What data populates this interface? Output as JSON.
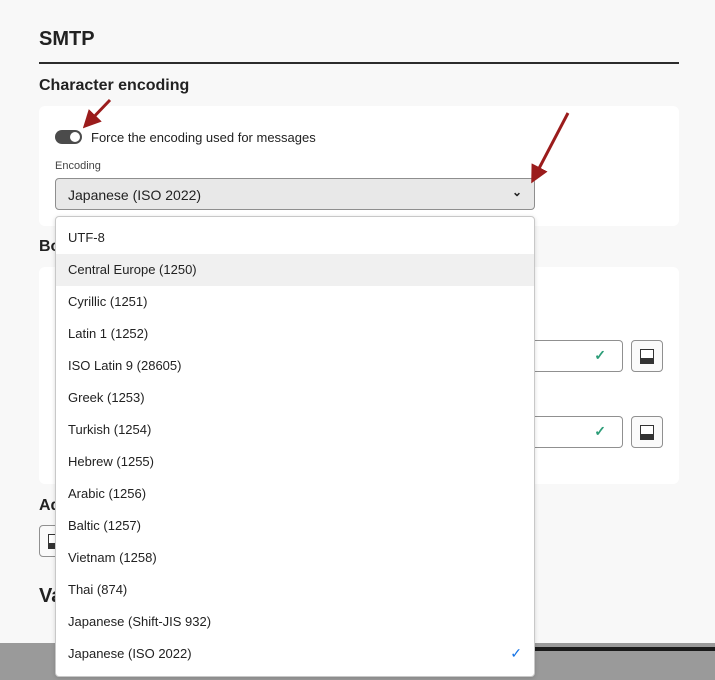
{
  "page": {
    "title": "SMTP"
  },
  "character_encoding": {
    "heading": "Character encoding",
    "toggle_label": "Force the encoding used for messages",
    "toggle_on": true,
    "encoding_label": "Encoding",
    "encoding_value": "Japanese (ISO 2022)"
  },
  "partial_headings": {
    "bounce": "Bo",
    "additional": "Ad",
    "validity": "Va"
  },
  "dropdown": {
    "options": [
      "UTF-8",
      "Central Europe (1250)",
      "Cyrillic (1251)",
      "Latin 1 (1252)",
      "ISO Latin 9 (28605)",
      "Greek (1253)",
      "Turkish (1254)",
      "Hebrew (1255)",
      "Arabic (1256)",
      "Baltic (1257)",
      "Vietnam (1258)",
      "Thai (874)",
      "Japanese (Shift-JIS 932)",
      "Japanese (ISO 2022)"
    ],
    "hovered": "Central Europe (1250)",
    "selected": "Japanese (ISO 2022)"
  },
  "colors": {
    "annotation_arrow": "#9b1c1c",
    "valid_check": "#2d9d78",
    "selected_check": "#1473e6"
  }
}
